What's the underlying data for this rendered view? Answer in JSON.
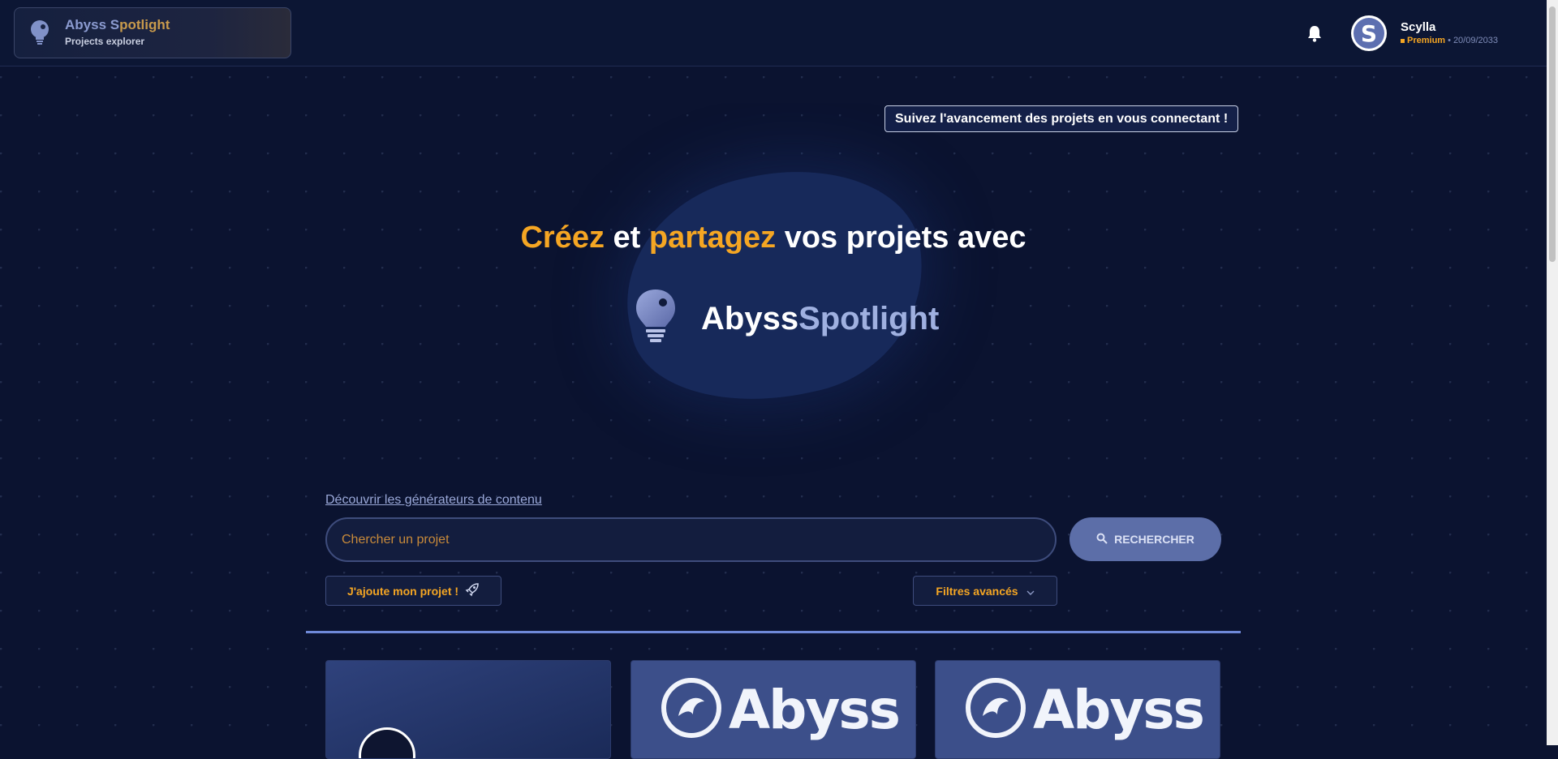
{
  "header": {
    "brand_title_a": "Abyss S",
    "brand_title_b": "potlight",
    "brand_subtitle": "Projects explorer",
    "user": {
      "name": "Scylla",
      "avatar_letter": "S",
      "plan": "Premium",
      "separator": "•",
      "date": "20/09/2033"
    }
  },
  "hero": {
    "follow_button": "Suivez l'avancement des projets en vous connectant !",
    "headline": {
      "w1": "Créez",
      "w2": " et ",
      "w3": "partagez",
      "w4": " vos projets avec"
    },
    "logo_a": "Abyss",
    "logo_b": "Spotlight"
  },
  "search": {
    "discover_link": "Découvrir les générateurs de contenu",
    "placeholder": "Chercher un projet",
    "value": "",
    "button_label": "RECHERCHER",
    "add_project": "J'ajoute mon projet !",
    "filters": "Filtres avancés"
  },
  "cards": [
    {
      "logo_text": ""
    },
    {
      "logo_text": "Abyss"
    },
    {
      "logo_text": "Abyss"
    }
  ],
  "colors": {
    "background": "#0b1330",
    "accent": "#f5a623",
    "primary": "#5c6ea8"
  },
  "icons": [
    "bulb-icon",
    "bell-icon",
    "search-icon",
    "rocket-icon",
    "chevron-down-icon"
  ]
}
